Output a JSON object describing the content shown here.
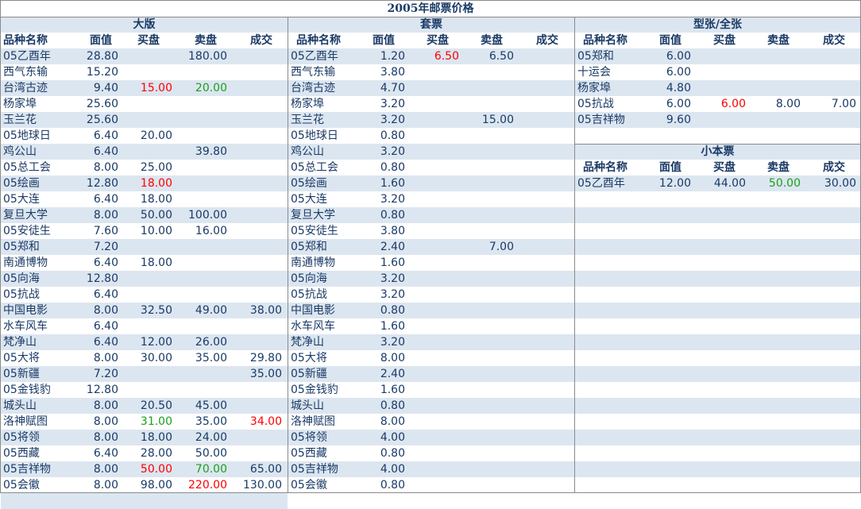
{
  "title": "2005年邮票价格",
  "columns": [
    "品种名称",
    "面值",
    "买盘",
    "卖盘",
    "成交"
  ],
  "panels": {
    "dabanj": {
      "title": "大版",
      "rows": [
        {
          "name": "05乙酉年",
          "face": "28.80",
          "buy": "",
          "sell": "180.00",
          "deal": ""
        },
        {
          "name": "西气东输",
          "face": "15.20",
          "buy": "",
          "sell": "",
          "deal": ""
        },
        {
          "name": "台湾古迹",
          "face": "9.40",
          "buy": "15.00",
          "buy_color": "red",
          "sell": "20.00",
          "sell_color": "green",
          "deal": ""
        },
        {
          "name": "杨家埠",
          "face": "25.60",
          "buy": "",
          "sell": "",
          "deal": ""
        },
        {
          "name": "玉兰花",
          "face": "25.60",
          "buy": "",
          "sell": "",
          "deal": ""
        },
        {
          "name": "05地球日",
          "face": "6.40",
          "buy": "20.00",
          "sell": "",
          "deal": ""
        },
        {
          "name": "鸡公山",
          "face": "6.40",
          "buy": "",
          "sell": "39.80",
          "deal": ""
        },
        {
          "name": "05总工会",
          "face": "8.00",
          "buy": "25.00",
          "sell": "",
          "deal": ""
        },
        {
          "name": "05绘画",
          "face": "12.80",
          "buy": "18.00",
          "buy_color": "red",
          "sell": "",
          "deal": ""
        },
        {
          "name": "05大连",
          "face": "6.40",
          "buy": "18.00",
          "sell": "",
          "deal": ""
        },
        {
          "name": "复旦大学",
          "face": "8.00",
          "buy": "50.00",
          "sell": "100.00",
          "deal": ""
        },
        {
          "name": "05安徒生",
          "face": "7.60",
          "buy": "10.00",
          "sell": "16.00",
          "deal": ""
        },
        {
          "name": "05郑和",
          "face": "7.20",
          "buy": "",
          "sell": "",
          "deal": ""
        },
        {
          "name": "南通博物",
          "face": "6.40",
          "buy": "18.00",
          "sell": "",
          "deal": ""
        },
        {
          "name": "05向海",
          "face": "12.80",
          "buy": "",
          "sell": "",
          "deal": ""
        },
        {
          "name": "05抗战",
          "face": "6.40",
          "buy": "",
          "sell": "",
          "deal": ""
        },
        {
          "name": "中国电影",
          "face": "8.00",
          "buy": "32.50",
          "sell": "49.00",
          "deal": "38.00"
        },
        {
          "name": "水车风车",
          "face": "6.40",
          "buy": "",
          "sell": "",
          "deal": ""
        },
        {
          "name": "梵净山",
          "face": "6.40",
          "buy": "12.00",
          "sell": "26.00",
          "deal": ""
        },
        {
          "name": "05大将",
          "face": "8.00",
          "buy": "30.00",
          "sell": "35.00",
          "deal": "29.80"
        },
        {
          "name": "05新疆",
          "face": "7.20",
          "buy": "",
          "sell": "",
          "deal": "35.00"
        },
        {
          "name": "05金钱豹",
          "face": "12.80",
          "buy": "",
          "sell": "",
          "deal": ""
        },
        {
          "name": "城头山",
          "face": "8.00",
          "buy": "20.50",
          "sell": "45.00",
          "deal": ""
        },
        {
          "name": "洛神赋图",
          "face": "8.00",
          "buy": "31.00",
          "buy_color": "green",
          "sell": "35.00",
          "deal": "34.00",
          "deal_color": "red"
        },
        {
          "name": "05将领",
          "face": "8.00",
          "buy": "18.00",
          "sell": "24.00",
          "deal": ""
        },
        {
          "name": "05西藏",
          "face": "6.40",
          "buy": "28.00",
          "sell": "50.00",
          "deal": ""
        },
        {
          "name": "05吉祥物",
          "face": "8.00",
          "buy": "50.00",
          "buy_color": "red",
          "sell": "70.00",
          "sell_color": "green",
          "deal": "65.00"
        },
        {
          "name": "05会徽",
          "face": "8.00",
          "buy": "98.00",
          "sell": "220.00",
          "sell_color": "red",
          "deal": "130.00"
        }
      ]
    },
    "taopiao": {
      "title": "套票",
      "rows": [
        {
          "name": "05乙酉年",
          "face": "1.20",
          "buy": "6.50",
          "buy_color": "red",
          "sell": "6.50",
          "deal": ""
        },
        {
          "name": "西气东输",
          "face": "3.80",
          "buy": "",
          "sell": "",
          "deal": ""
        },
        {
          "name": "台湾古迹",
          "face": "4.70",
          "buy": "",
          "sell": "",
          "deal": ""
        },
        {
          "name": "杨家埠",
          "face": "3.20",
          "buy": "",
          "sell": "",
          "deal": ""
        },
        {
          "name": "玉兰花",
          "face": "3.20",
          "buy": "",
          "sell": "15.00",
          "deal": ""
        },
        {
          "name": "05地球日",
          "face": "0.80",
          "buy": "",
          "sell": "",
          "deal": ""
        },
        {
          "name": "鸡公山",
          "face": "3.20",
          "buy": "",
          "sell": "",
          "deal": ""
        },
        {
          "name": "05总工会",
          "face": "0.80",
          "buy": "",
          "sell": "",
          "deal": ""
        },
        {
          "name": "05绘画",
          "face": "1.60",
          "buy": "",
          "sell": "",
          "deal": ""
        },
        {
          "name": "05大连",
          "face": "3.20",
          "buy": "",
          "sell": "",
          "deal": ""
        },
        {
          "name": "复旦大学",
          "face": "0.80",
          "buy": "",
          "sell": "",
          "deal": ""
        },
        {
          "name": "05安徒生",
          "face": "3.80",
          "buy": "",
          "sell": "",
          "deal": ""
        },
        {
          "name": "05郑和",
          "face": "2.40",
          "buy": "",
          "sell": "7.00",
          "deal": ""
        },
        {
          "name": "南通博物",
          "face": "1.60",
          "buy": "",
          "sell": "",
          "deal": ""
        },
        {
          "name": "05向海",
          "face": "3.20",
          "buy": "",
          "sell": "",
          "deal": ""
        },
        {
          "name": "05抗战",
          "face": "3.20",
          "buy": "",
          "sell": "",
          "deal": ""
        },
        {
          "name": "中国电影",
          "face": "0.80",
          "buy": "",
          "sell": "",
          "deal": ""
        },
        {
          "name": "水车风车",
          "face": "1.60",
          "buy": "",
          "sell": "",
          "deal": ""
        },
        {
          "name": "梵净山",
          "face": "3.20",
          "buy": "",
          "sell": "",
          "deal": ""
        },
        {
          "name": "05大将",
          "face": "8.00",
          "buy": "",
          "sell": "",
          "deal": ""
        },
        {
          "name": "05新疆",
          "face": "2.40",
          "buy": "",
          "sell": "",
          "deal": ""
        },
        {
          "name": "05金钱豹",
          "face": "1.60",
          "buy": "",
          "sell": "",
          "deal": ""
        },
        {
          "name": "城头山",
          "face": "0.80",
          "buy": "",
          "sell": "",
          "deal": ""
        },
        {
          "name": "洛神赋图",
          "face": "8.00",
          "buy": "",
          "sell": "",
          "deal": ""
        },
        {
          "name": "05将领",
          "face": "4.00",
          "buy": "",
          "sell": "",
          "deal": ""
        },
        {
          "name": "05西藏",
          "face": "0.80",
          "buy": "",
          "sell": "",
          "deal": ""
        },
        {
          "name": "05吉祥物",
          "face": "4.00",
          "buy": "",
          "sell": "",
          "deal": ""
        },
        {
          "name": "05会徽",
          "face": "0.80",
          "buy": "",
          "sell": "",
          "deal": ""
        }
      ]
    },
    "xingzhang": {
      "title": "型张/全张",
      "rows": [
        {
          "name": "05郑和",
          "face": "6.00",
          "buy": "",
          "sell": "",
          "deal": ""
        },
        {
          "name": "十运会",
          "face": "6.00",
          "buy": "",
          "sell": "",
          "deal": ""
        },
        {
          "name": "杨家埠",
          "face": "4.80",
          "buy": "",
          "sell": "",
          "deal": ""
        },
        {
          "name": "05抗战",
          "face": "6.00",
          "buy": "6.00",
          "buy_color": "red",
          "sell": "8.00",
          "deal": "7.00"
        },
        {
          "name": "05吉祥物",
          "face": "9.60",
          "buy": "",
          "sell": "",
          "deal": ""
        }
      ]
    },
    "xiaoben": {
      "title": "小本票",
      "rows": [
        {
          "name": "05乙酉年",
          "face": "12.00",
          "buy": "44.00",
          "sell": "50.00",
          "sell_color": "green",
          "deal": "30.00"
        }
      ]
    }
  }
}
